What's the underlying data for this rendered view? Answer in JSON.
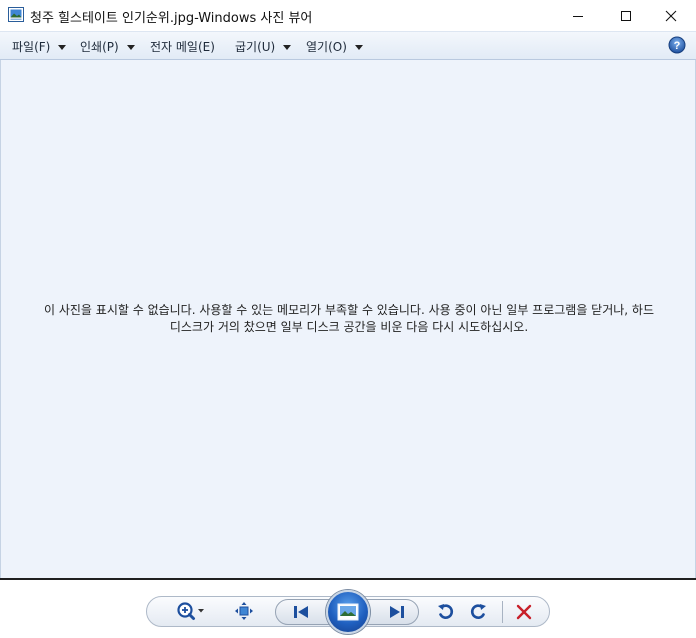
{
  "window": {
    "title": "청주 힐스테이트 인기순위.jpg-Windows 사진 뷰어",
    "app_icon": "photo-viewer-icon",
    "controls": [
      "minimize-icon",
      "maximize-icon",
      "close-icon"
    ]
  },
  "menubar": {
    "items": [
      {
        "label": "파일(F)",
        "has_dropdown": true
      },
      {
        "label": "인쇄(P)",
        "has_dropdown": true
      },
      {
        "label": "전자 메일(E)",
        "has_dropdown": false
      },
      {
        "label": "굽기(U)",
        "has_dropdown": true
      },
      {
        "label": "열기(O)",
        "has_dropdown": true
      }
    ],
    "help_icon": "help-icon"
  },
  "viewer": {
    "error_line1": "이 사진을 표시할 수 없습니다. 사용할 수 있는 메모리가 부족할 수 있습니다. 사용 중이 아닌 일부 프로그램을 닫거나, 하드",
    "error_line2": "디스크가 거의 찼으면 일부 디스크 공간을 비운 다음 다시 시도하십시오."
  },
  "toolbar": {
    "buttons": [
      "zoom-icon",
      "actual-size-icon",
      "previous-icon",
      "slideshow-icon",
      "next-icon",
      "rotate-counterclockwise-icon",
      "rotate-clockwise-icon",
      "delete-icon"
    ]
  },
  "colors": {
    "accent_blue": "#1f5fbf",
    "delete_red": "#c8202a",
    "viewer_background": "#eef3fb"
  }
}
